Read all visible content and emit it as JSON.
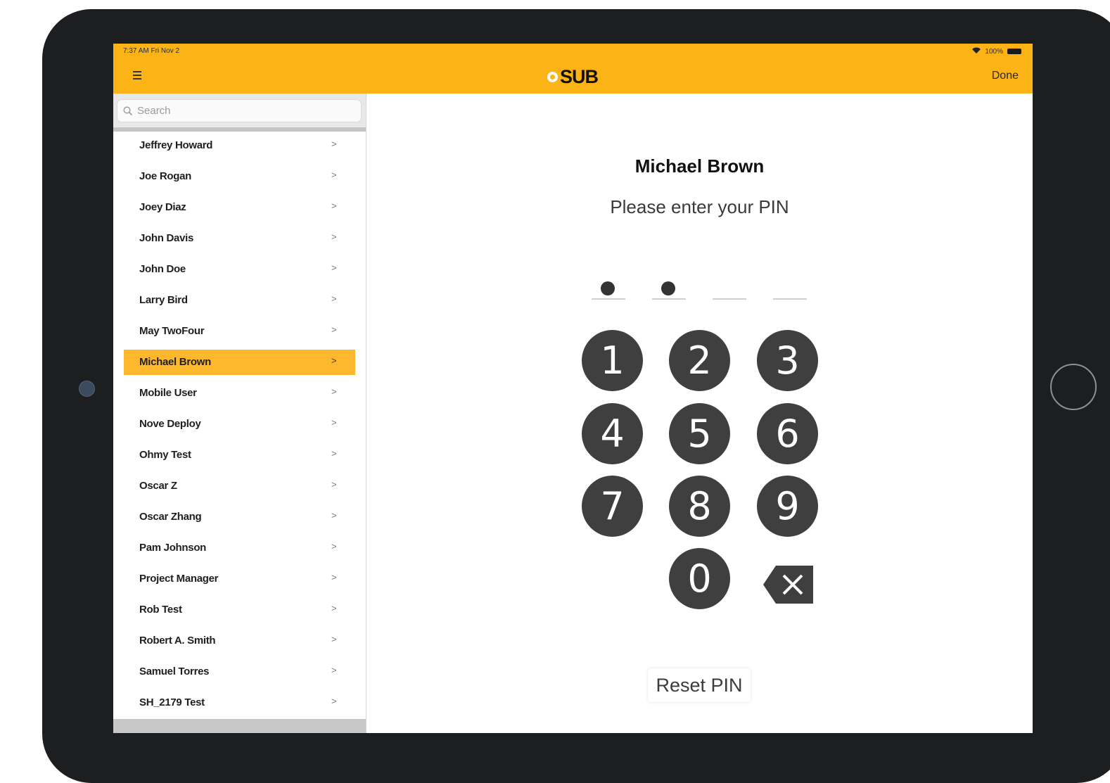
{
  "status_bar": {
    "time_date": "7:37 AM  Fri Nov 2",
    "right": "100%"
  },
  "navbar": {
    "logo_text": "SUB",
    "done_label": "Done"
  },
  "search": {
    "placeholder": "Search"
  },
  "users": [
    "Jeffrey Howard",
    "Joe Rogan",
    "Joey Diaz",
    "John Davis",
    "John Doe",
    "Larry Bird",
    "May TwoFour",
    "Michael Brown",
    "Mobile User",
    "Nove Deploy",
    "Ohmy Test",
    "Oscar Z",
    "Oscar Zhang",
    "Pam Johnson",
    "Project Manager",
    "Rob Test",
    "Robert A. Smith",
    "Samuel Torres",
    "SH_2179 Test"
  ],
  "selected_user": "Michael Brown",
  "pin_panel": {
    "name": "Michael Brown",
    "prompt": "Please enter your PIN",
    "digits_entered": 2,
    "digits_total": 4
  },
  "keypad": {
    "keys": [
      "1",
      "2",
      "3",
      "4",
      "5",
      "6",
      "7",
      "8",
      "9",
      "0"
    ]
  },
  "reset_label": "Reset PIN",
  "colors": {
    "accent": "#fcb316",
    "key": "#3f3f3f",
    "device": "#1d1e20"
  },
  "icons": {
    "menu": "hamburger-icon",
    "search": "search-icon",
    "chevron": "chevron-right-icon",
    "backspace": "backspace-icon"
  }
}
